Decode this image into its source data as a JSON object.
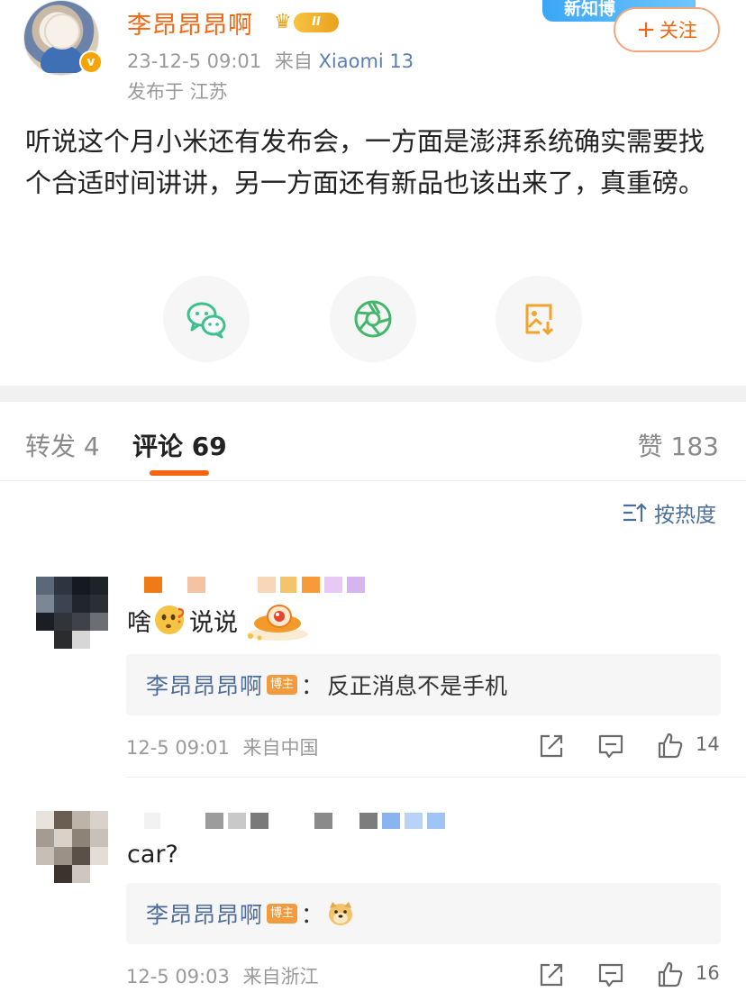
{
  "post": {
    "author": "李昂昂昂啊",
    "vip_level": "II",
    "time": "23-12-5 09:01",
    "from_label": "来自",
    "source": "Xiaomi 13",
    "location": "发布于 江苏",
    "banner": "新知博",
    "follow_label": "关注",
    "content": "听说这个月小米还有发布会，一方面是澎湃系统确实需要找个合适时间讲讲，另一方面还有新品也该出来了，真重磅。"
  },
  "share": [
    "wechat-icon",
    "moments-icon",
    "save-image-icon"
  ],
  "tabs": {
    "repost": "转发 4",
    "comments": "评论 69",
    "likes": "赞 183"
  },
  "sort": {
    "label": "按热度"
  },
  "comments": [
    {
      "text_before": "啥",
      "text_after": "说说",
      "emoji": "thinking-face",
      "reply": {
        "name": "李昂昂昂啊",
        "tag": "博主",
        "colon": "：",
        "text": "反正消息不是手机"
      },
      "time": "12-5 09:01",
      "from": "来自中国",
      "likes": "14"
    },
    {
      "text_before": "car?",
      "reply": {
        "name": "李昂昂昂啊",
        "tag": "博主",
        "colon": "：",
        "emoji": "doge-face"
      },
      "time": "12-5 09:03",
      "from": "来自浙江",
      "likes": "16"
    }
  ],
  "colors": {
    "accent": "#f5640f",
    "link": "#4e6c9a",
    "muted": "#9a9a9a",
    "host_tag": "#f19a3e"
  }
}
